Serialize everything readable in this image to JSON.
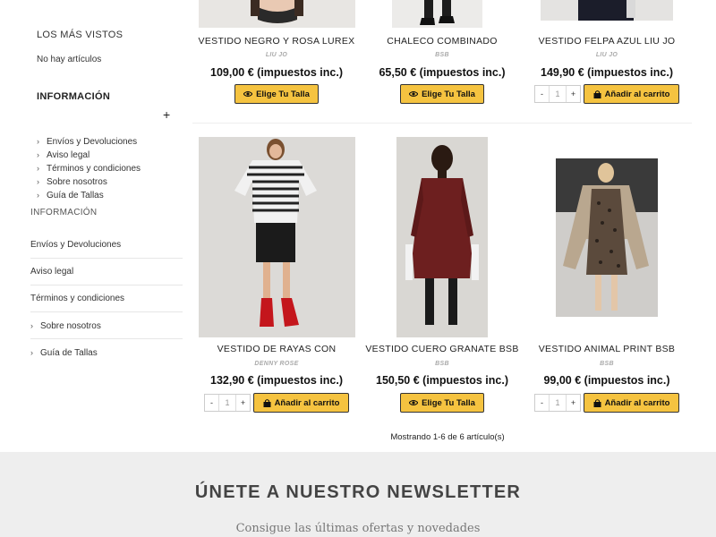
{
  "sidebar": {
    "most_viewed_heading": "LOS MÁS VISTOS",
    "no_items": "No hay artículos",
    "info_heading": "INFORMACIÓN",
    "expand_symbol": "+",
    "chevron": "›",
    "info_links_1": [
      "Envíos y Devoluciones",
      "Aviso legal",
      "Términos y condiciones",
      "Sobre nosotros",
      "Guía de Tallas"
    ],
    "info_heading_2": "INFORMACIÓN",
    "info_links_2": [
      "Envíos y Devoluciones",
      "Aviso legal",
      "Términos y condiciones",
      "Sobre nosotros",
      "Guía de Tallas"
    ]
  },
  "products": [
    {
      "name": "VESTIDO NEGRO Y ROSA LUREX",
      "brand": "LIU JO",
      "price": "109,00 €",
      "tax": "(impuestos inc.)",
      "action": "Elige Tu Talla",
      "type": "size"
    },
    {
      "name": "CHALECO COMBINADO",
      "brand": "BSB",
      "price": "65,50 €",
      "tax": "(impuestos inc.)",
      "action": "Elige Tu Talla",
      "type": "size"
    },
    {
      "name": "VESTIDO FELPA AZUL LIU JO",
      "brand": "LIU JO",
      "price": "149,90 €",
      "tax": "(impuestos inc.)",
      "action": "Añadir al carrito",
      "type": "cart",
      "qty": "1"
    },
    {
      "name": "VESTIDO DE RAYAS CON",
      "brand": "DENNY ROSE",
      "price": "132,90 €",
      "tax": "(impuestos inc.)",
      "action": "Añadir al carrito",
      "type": "cart",
      "qty": "1"
    },
    {
      "name": "VESTIDO CUERO GRANATE BSB",
      "brand": "BSB",
      "price": "150,50 €",
      "tax": "(impuestos inc.)",
      "action": "Elige Tu Talla",
      "type": "size"
    },
    {
      "name": "VESTIDO ANIMAL PRINT BSB",
      "brand": "BSB",
      "price": "99,00 €",
      "tax": "(impuestos inc.)",
      "action": "Añadir al carrito",
      "type": "cart",
      "qty": "1"
    }
  ],
  "qty_minus": "-",
  "qty_plus": "+",
  "showing": "Mostrando 1-6 de 6 artículo(s)",
  "newsletter": {
    "title": "ÚNETE A NUESTRO NEWSLETTER",
    "subtitle": "Consigue las últimas ofertas y novedades"
  },
  "colors": {
    "button_accent": "#f5c340",
    "newsletter_bg": "#eeeeee"
  },
  "icons": {
    "size_button": "eye-icon",
    "cart_button": "shopping-bag-icon"
  }
}
